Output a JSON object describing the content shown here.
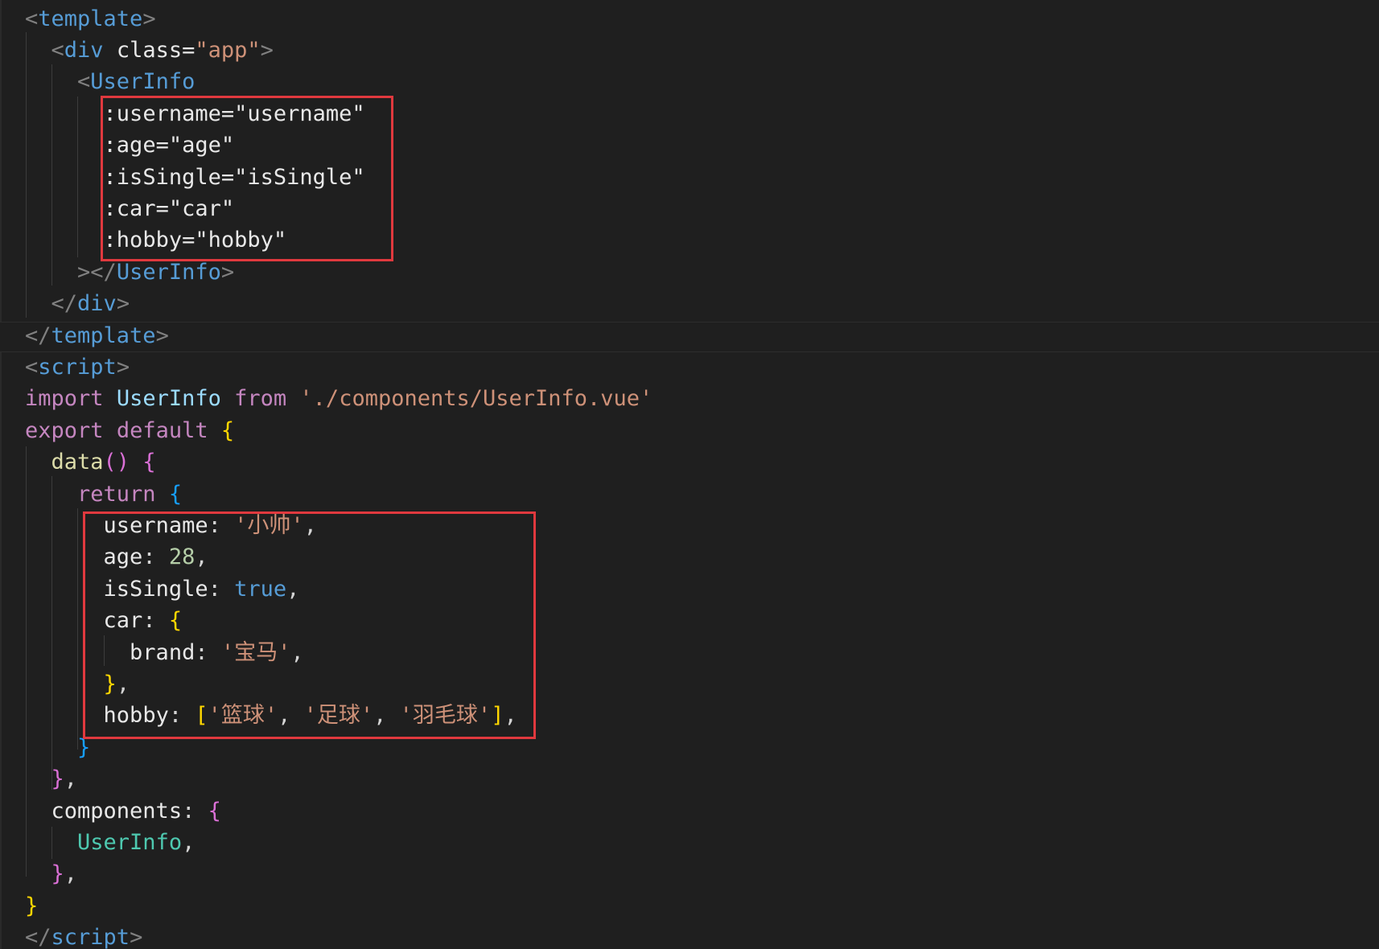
{
  "editor": {
    "language": "vue",
    "highlight_color": "#e0393e",
    "lines": [
      [
        {
          "t": "<",
          "c": "t-punc"
        },
        {
          "t": "template",
          "c": "t-tag"
        },
        {
          "t": ">",
          "c": "t-punc"
        }
      ],
      [
        {
          "t": "  "
        },
        {
          "t": "<",
          "c": "t-punc"
        },
        {
          "t": "div",
          "c": "t-tag"
        },
        {
          "t": " "
        },
        {
          "t": "class",
          "c": "t-white"
        },
        {
          "t": "=",
          "c": "t-white"
        },
        {
          "t": "\"app\"",
          "c": "t-str"
        },
        {
          "t": ">",
          "c": "t-punc"
        }
      ],
      [
        {
          "t": "    "
        },
        {
          "t": "<",
          "c": "t-punc"
        },
        {
          "t": "UserInfo",
          "c": "t-tag"
        }
      ],
      [
        {
          "t": "      "
        },
        {
          "t": ":username=\"username\"",
          "c": "t-white"
        }
      ],
      [
        {
          "t": "      "
        },
        {
          "t": ":age=\"age\"",
          "c": "t-white"
        }
      ],
      [
        {
          "t": "      "
        },
        {
          "t": ":isSingle=\"isSingle\"",
          "c": "t-white"
        }
      ],
      [
        {
          "t": "      "
        },
        {
          "t": ":car=\"car\"",
          "c": "t-white"
        }
      ],
      [
        {
          "t": "      "
        },
        {
          "t": ":hobby=\"hobby\"",
          "c": "t-white"
        }
      ],
      [
        {
          "t": "    "
        },
        {
          "t": "></",
          "c": "t-punc"
        },
        {
          "t": "UserInfo",
          "c": "t-tag"
        },
        {
          "t": ">",
          "c": "t-punc"
        }
      ],
      [
        {
          "t": "  "
        },
        {
          "t": "</",
          "c": "t-punc"
        },
        {
          "t": "div",
          "c": "t-tag"
        },
        {
          "t": ">",
          "c": "t-punc"
        }
      ],
      [
        {
          "t": "</",
          "c": "t-punc"
        },
        {
          "t": "template",
          "c": "t-tag"
        },
        {
          "t": ">",
          "c": "t-punc"
        }
      ],
      [
        {
          "t": "<",
          "c": "t-punc"
        },
        {
          "t": "script",
          "c": "t-tag"
        },
        {
          "t": ">",
          "c": "t-punc"
        }
      ],
      [
        {
          "t": "import",
          "c": "t-kw"
        },
        {
          "t": " "
        },
        {
          "t": "UserInfo",
          "c": "t-ident"
        },
        {
          "t": " "
        },
        {
          "t": "from",
          "c": "t-kw"
        },
        {
          "t": " "
        },
        {
          "t": "'./components/UserInfo.vue'",
          "c": "t-str"
        }
      ],
      [
        {
          "t": "export",
          "c": "t-kw"
        },
        {
          "t": " "
        },
        {
          "t": "default",
          "c": "t-kw"
        },
        {
          "t": " "
        },
        {
          "t": "{",
          "c": "b1"
        }
      ],
      [
        {
          "t": "  "
        },
        {
          "t": "data",
          "c": "t-fn"
        },
        {
          "t": "()",
          "c": "b2"
        },
        {
          "t": " "
        },
        {
          "t": "{",
          "c": "b2"
        }
      ],
      [
        {
          "t": "    "
        },
        {
          "t": "return",
          "c": "t-kw"
        },
        {
          "t": " "
        },
        {
          "t": "{",
          "c": "b3"
        }
      ],
      [
        {
          "t": "      "
        },
        {
          "t": "username",
          "c": "t-white"
        },
        {
          "t": ": "
        },
        {
          "t": "'小帅'",
          "c": "t-str"
        },
        {
          "t": ","
        }
      ],
      [
        {
          "t": "      "
        },
        {
          "t": "age",
          "c": "t-white"
        },
        {
          "t": ": "
        },
        {
          "t": "28",
          "c": "t-num"
        },
        {
          "t": ","
        }
      ],
      [
        {
          "t": "      "
        },
        {
          "t": "isSingle",
          "c": "t-white"
        },
        {
          "t": ": "
        },
        {
          "t": "true",
          "c": "t-bool"
        },
        {
          "t": ","
        }
      ],
      [
        {
          "t": "      "
        },
        {
          "t": "car",
          "c": "t-white"
        },
        {
          "t": ": "
        },
        {
          "t": "{",
          "c": "b1"
        }
      ],
      [
        {
          "t": "        "
        },
        {
          "t": "brand",
          "c": "t-white"
        },
        {
          "t": ": "
        },
        {
          "t": "'宝马'",
          "c": "t-str"
        },
        {
          "t": ","
        }
      ],
      [
        {
          "t": "      "
        },
        {
          "t": "}",
          "c": "b1"
        },
        {
          "t": ","
        }
      ],
      [
        {
          "t": "      "
        },
        {
          "t": "hobby",
          "c": "t-white"
        },
        {
          "t": ": "
        },
        {
          "t": "[",
          "c": "b1"
        },
        {
          "t": "'篮球'",
          "c": "t-str"
        },
        {
          "t": ", "
        },
        {
          "t": "'足球'",
          "c": "t-str"
        },
        {
          "t": ", "
        },
        {
          "t": "'羽毛球'",
          "c": "t-str"
        },
        {
          "t": "]",
          "c": "b1"
        },
        {
          "t": ","
        }
      ],
      [
        {
          "t": "    "
        },
        {
          "t": "}",
          "c": "b3"
        }
      ],
      [
        {
          "t": "  "
        },
        {
          "t": "}",
          "c": "b2"
        },
        {
          "t": ","
        }
      ],
      [
        {
          "t": "  "
        },
        {
          "t": "components",
          "c": "t-white"
        },
        {
          "t": ": "
        },
        {
          "t": "{",
          "c": "b2"
        }
      ],
      [
        {
          "t": "    "
        },
        {
          "t": "UserInfo",
          "c": "t-comp"
        },
        {
          "t": ","
        }
      ],
      [
        {
          "t": "  "
        },
        {
          "t": "}",
          "c": "b2"
        },
        {
          "t": ","
        }
      ],
      [
        {
          "t": "}",
          "c": "b1"
        }
      ],
      [
        {
          "t": "</",
          "c": "t-punc"
        },
        {
          "t": "script",
          "c": "t-tag"
        },
        {
          "t": ">",
          "c": "t-punc"
        }
      ]
    ]
  }
}
